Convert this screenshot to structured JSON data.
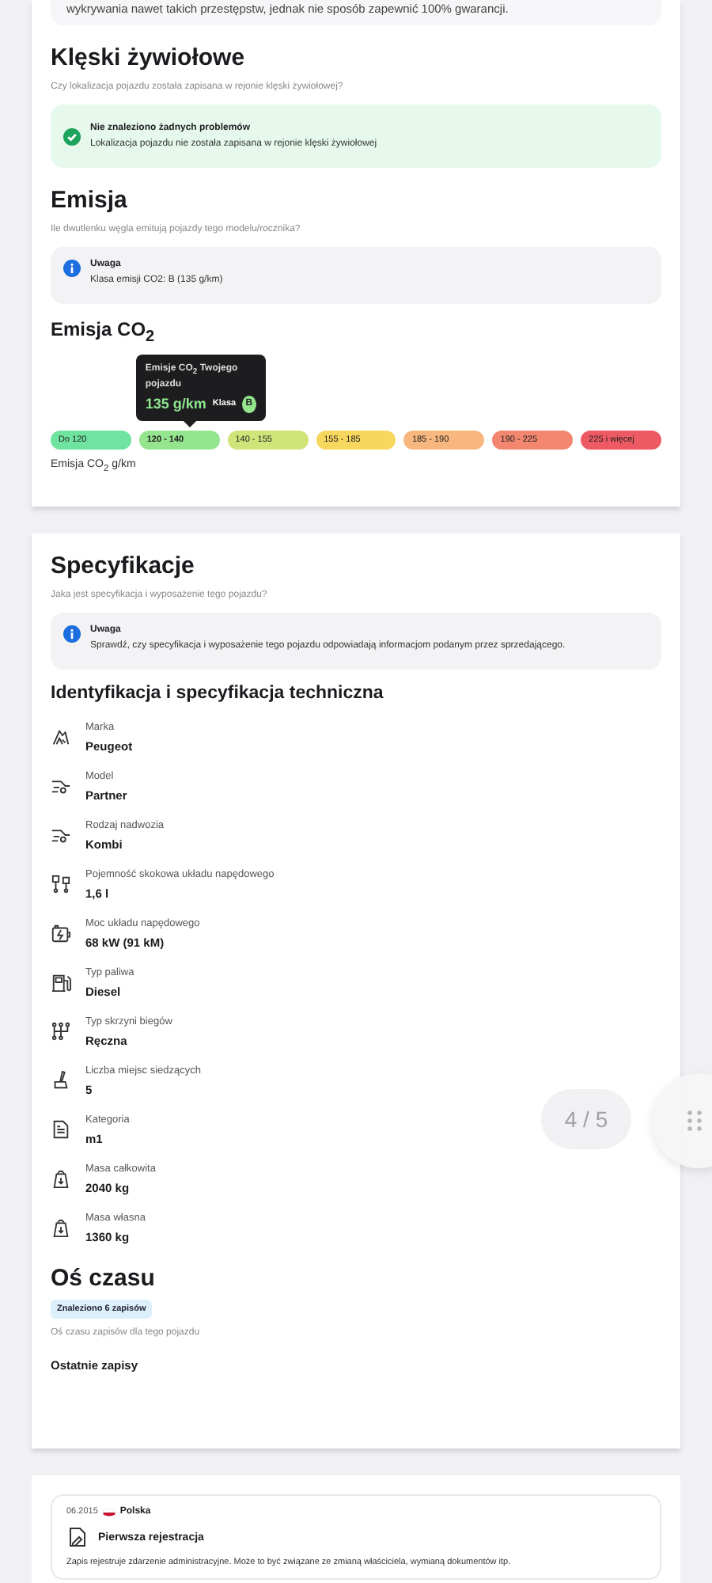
{
  "top_note": "wykrywania nawet takich przestępstw, jednak nie sposób zapewnić 100% gwarancji.",
  "disasters": {
    "title": "Klęski żywiołowe",
    "subtitle": "Czy lokalizacja pojazdu została zapisana w rejonie klęski żywiołowej?",
    "alert": {
      "kind": "success",
      "title": "Nie znaleziono żadnych problemów",
      "text": "Lokalizacja pojazdu nie została zapisana w rejonie klęski żywiołowej"
    }
  },
  "emission": {
    "title": "Emisja",
    "subtitle": "Ile dwutlenku węgla emitują pojazdy tego modelu/rocznika?",
    "alert": {
      "kind": "info",
      "title": "Uwaga",
      "text": "Klasa emisji CO2: B (135 g/km)"
    },
    "co2_title": "Emisja CO$_{2}$",
    "tooltip": {
      "label": "Emisje CO$_{2}$ Twojego pojazdu",
      "value": "135 g/km",
      "class_label": "Klasa",
      "class": "B"
    },
    "scale": [
      {
        "label": "Do 120",
        "color": "#6fe3a0",
        "selected": false
      },
      {
        "label": "120 - 140",
        "color": "#95e58f",
        "selected": true
      },
      {
        "label": "140 - 155",
        "color": "#cfe57a",
        "selected": false
      },
      {
        "label": "155 - 185",
        "color": "#f8d75e",
        "selected": false
      },
      {
        "label": "185 - 190",
        "color": "#f8b77e",
        "selected": false
      },
      {
        "label": "190 - 225",
        "color": "#f2866f",
        "selected": false
      },
      {
        "label": "225 i więcej",
        "color": "#ee5a63",
        "selected": false
      }
    ],
    "unit": "Emisja CO$_{2}$ g/km"
  },
  "specs": {
    "title": "Specyfikacje",
    "subtitle": "Jaka jest specyfikacja i wyposażenie tego pojazdu?",
    "alert": {
      "kind": "info",
      "title": "Uwaga",
      "text": "Sprawdź, czy specyfikacja i wyposażenie tego pojazdu odpowiadają informacjom podanym przez sprzedającego."
    },
    "section_title": "Identyfikacja i specyfikacja techniczna",
    "items": [
      {
        "label": "Marka",
        "value": "Peugeot"
      },
      {
        "label": "Model",
        "value": "Partner"
      },
      {
        "label": "Rodzaj nadwozia",
        "value": "Kombi"
      },
      {
        "label": "Pojemność skokowa układu napędowego",
        "value": "1,6 l"
      },
      {
        "label": "Moc układu napędowego",
        "value": "68 kW (91 kM)"
      },
      {
        "label": "Typ paliwa",
        "value": "Diesel"
      },
      {
        "label": "Typ skrzyni biegów",
        "value": "Ręczna"
      },
      {
        "label": "Liczba miejsc siedzących",
        "value": "5"
      },
      {
        "label": "Kategoria",
        "value": "m1"
      },
      {
        "label": "Masa całkowita",
        "value": "2040 kg"
      },
      {
        "label": "Masa własna",
        "value": "1360 kg"
      }
    ]
  },
  "timeline": {
    "title": "Oś czasu",
    "badge": "Znaleziono 6 zapisów",
    "subtitle": "Oś czasu zapisów dla tego pojazdu",
    "recent_title": "Ostatnie zapisy",
    "entry": {
      "date": "06.2015",
      "country": "Polska",
      "title": "Pierwsza rejestracja",
      "text": "Zapis rejestruje zdarzenie administracyjne. Może to być związane ze zmianą właściciela, wymianą dokumentów itp."
    }
  },
  "pager": "4 / 5"
}
